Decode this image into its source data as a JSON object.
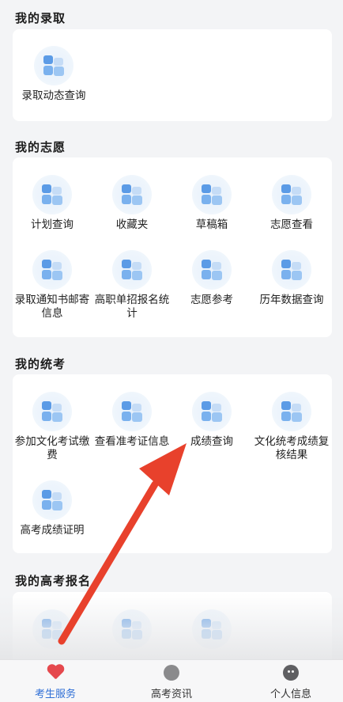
{
  "sections": {
    "admission": {
      "title": "我的录取",
      "items": [
        {
          "label": "录取动态查询"
        }
      ]
    },
    "wish": {
      "title": "我的志愿",
      "items": [
        {
          "label": "计划查询"
        },
        {
          "label": "收藏夹"
        },
        {
          "label": "草稿箱"
        },
        {
          "label": "志愿查看"
        },
        {
          "label": "录取通知书邮寄信息"
        },
        {
          "label": "高职单招报名统计"
        },
        {
          "label": "志愿参考"
        },
        {
          "label": "历年数据查询"
        }
      ]
    },
    "exam": {
      "title": "我的统考",
      "items": [
        {
          "label": "参加文化考试缴费"
        },
        {
          "label": "查看准考证信息"
        },
        {
          "label": "成绩查询"
        },
        {
          "label": "文化统考成绩复核结果"
        },
        {
          "label": "高考成绩证明"
        }
      ]
    },
    "gaokao": {
      "title": "我的高考报名"
    }
  },
  "tabbar": {
    "items": [
      {
        "label": "考生服务",
        "icon": "heart-icon",
        "active": true
      },
      {
        "label": "高考资讯",
        "icon": "news-icon",
        "active": false
      },
      {
        "label": "个人信息",
        "icon": "person-icon",
        "active": false
      }
    ]
  },
  "colors": {
    "accent": "#2f6fd6",
    "arrow": "#e8412c",
    "heart": "#e5484d"
  }
}
